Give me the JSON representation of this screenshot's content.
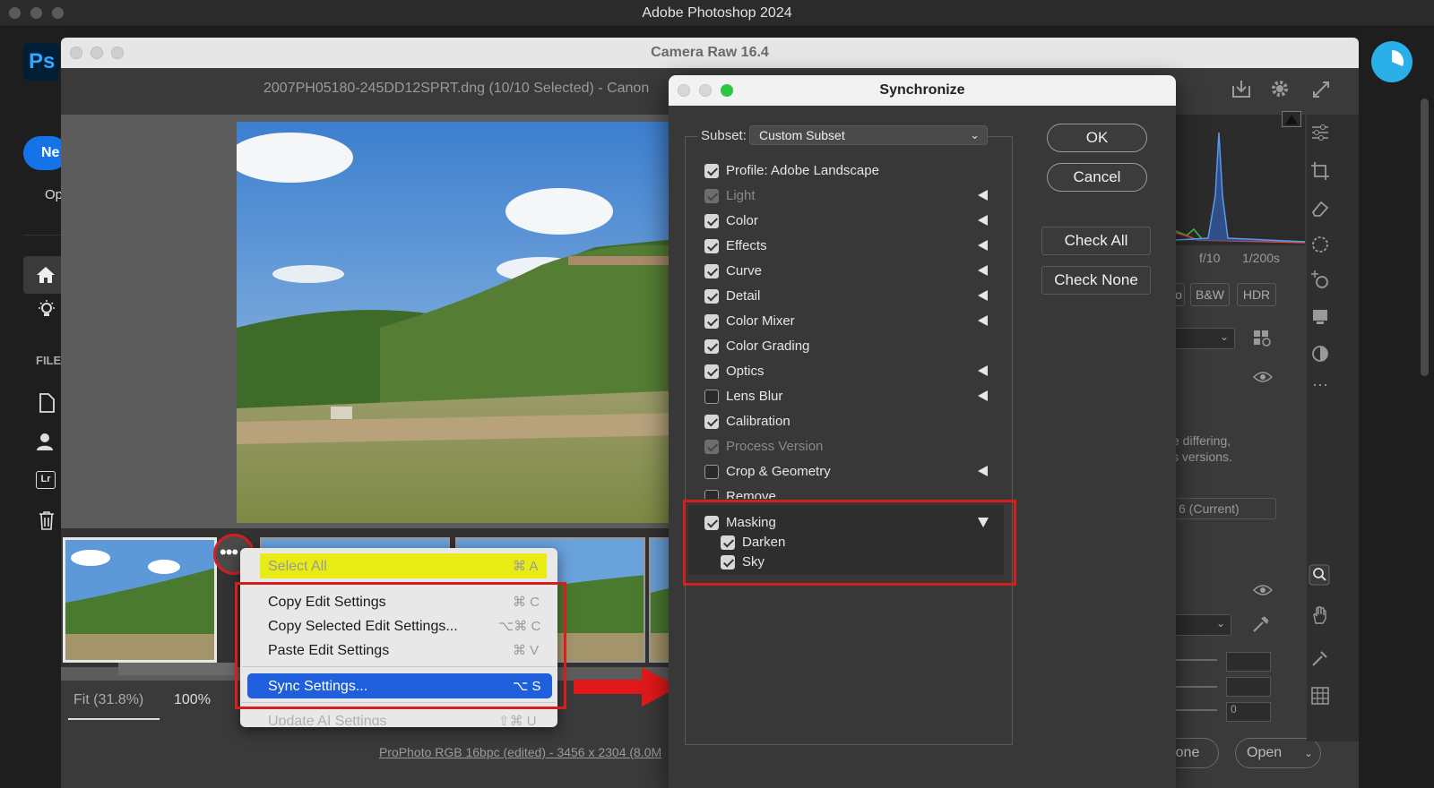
{
  "app": {
    "title": "Adobe Photoshop 2024",
    "logo": "Ps"
  },
  "ps_rail": {
    "new_label": "Ne",
    "open_label": "Op",
    "file_heading": "FILE",
    "lr_badge": "Lr",
    "icons": [
      "home-icon",
      "lightbulb-icon",
      "document-icon",
      "people-icon",
      "lightroom-icon",
      "trash-icon"
    ]
  },
  "camera_raw": {
    "title": "Camera Raw 16.4",
    "filename": "2007PH05180-245DD12SPRT.dng (10/10 Selected)  -  Canon",
    "zoom_fit": "Fit (31.8%)",
    "zoom_100": "100%",
    "bottom_link": "ProPhoto RGB 16bpc (edited) - 3456 x 2304 (8.0M",
    "done_label": "one",
    "open_label": "Open",
    "histogram_labels": [
      "f/10",
      "1/200s"
    ],
    "profile_buttons": [
      "o",
      "B&W",
      "HDR"
    ],
    "note_text": [
      "e differing,",
      "s versions."
    ],
    "version_field": "6 (Current)",
    "slider_value": "0"
  },
  "context_menu": {
    "items": [
      {
        "label": "Select All",
        "shortcut": "⌘ A"
      },
      {
        "label": "Copy Edit Settings",
        "shortcut": "⌘ C"
      },
      {
        "label": "Copy Selected Edit Settings...",
        "shortcut": "⌥⌘ C"
      },
      {
        "label": "Paste Edit Settings",
        "shortcut": "⌘ V"
      },
      {
        "label": "Sync Settings...",
        "shortcut": "⌥ S"
      },
      {
        "label": "Update AI Settings",
        "shortcut": "⇧⌘ U"
      }
    ]
  },
  "sync_dialog": {
    "title": "Synchronize",
    "subset_label": "Subset:",
    "subset_value": "Custom Subset",
    "ok_label": "OK",
    "cancel_label": "Cancel",
    "check_all_label": "Check All",
    "check_none_label": "Check None",
    "items": [
      {
        "label": "Profile: Adobe Landscape",
        "checked": true
      },
      {
        "label": "Light",
        "checked": true,
        "disabled": true
      },
      {
        "label": "Color",
        "checked": true
      },
      {
        "label": "Effects",
        "checked": true
      },
      {
        "label": "Curve",
        "checked": true
      },
      {
        "label": "Detail",
        "checked": true
      },
      {
        "label": "Color Mixer",
        "checked": true
      },
      {
        "label": "Color Grading",
        "checked": true
      },
      {
        "label": "Optics",
        "checked": true
      },
      {
        "label": "Lens Blur",
        "checked": false
      },
      {
        "label": "Calibration",
        "checked": true
      },
      {
        "label": "Process Version",
        "checked": true,
        "disabled": true
      },
      {
        "label": "Crop & Geometry",
        "checked": false
      },
      {
        "label": "Remove",
        "checked": false
      }
    ],
    "masking": {
      "label": "Masking",
      "checked": true,
      "children": [
        {
          "label": "Darken",
          "checked": true
        },
        {
          "label": "Sky",
          "checked": true
        }
      ]
    }
  },
  "colors": {
    "highlight_yellow": "#e8ec14",
    "selection_blue": "#1f5fdc",
    "annotation_red": "#d51f1f",
    "ps_blue": "#31a8ff"
  }
}
